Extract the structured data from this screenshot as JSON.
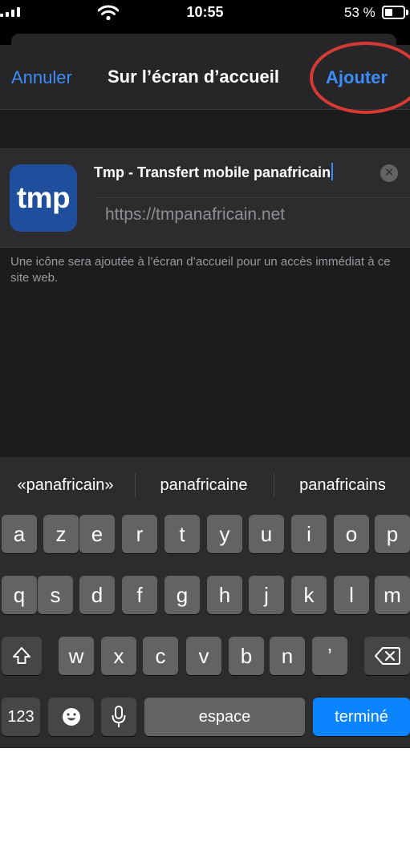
{
  "status_bar": {
    "time": "10:55",
    "battery_text": "53 %",
    "battery_level": 0.53
  },
  "nav": {
    "cancel_label": "Annuler",
    "title": "Sur l’écran d’accueil",
    "add_label": "Ajouter"
  },
  "bookmark": {
    "icon_text": "tmp",
    "name_value": "Tmp - Transfert mobile panafricain",
    "url": "https://tmpanafricain.net"
  },
  "hint_text": "Une icône sera ajoutée à l’écran d’accueil pour un accès immédiat à ce site web.",
  "keyboard": {
    "suggestions": [
      "«panafricain»",
      "panafricaine",
      "panafricains"
    ],
    "row1": [
      "a",
      "z",
      "e",
      "r",
      "t",
      "y",
      "u",
      "i",
      "o",
      "p"
    ],
    "row2": [
      "q",
      "s",
      "d",
      "f",
      "g",
      "h",
      "j",
      "k",
      "l",
      "m"
    ],
    "row3": [
      "w",
      "x",
      "c",
      "v",
      "b",
      "n",
      "’"
    ],
    "numbers_label": "123",
    "space_label": "espace",
    "done_label": "terminé"
  },
  "colors": {
    "accent": "#3b8cf7",
    "done_key": "#0a84ff",
    "icon_bg": "#1f4f9c",
    "annotation": "#d63a34"
  }
}
